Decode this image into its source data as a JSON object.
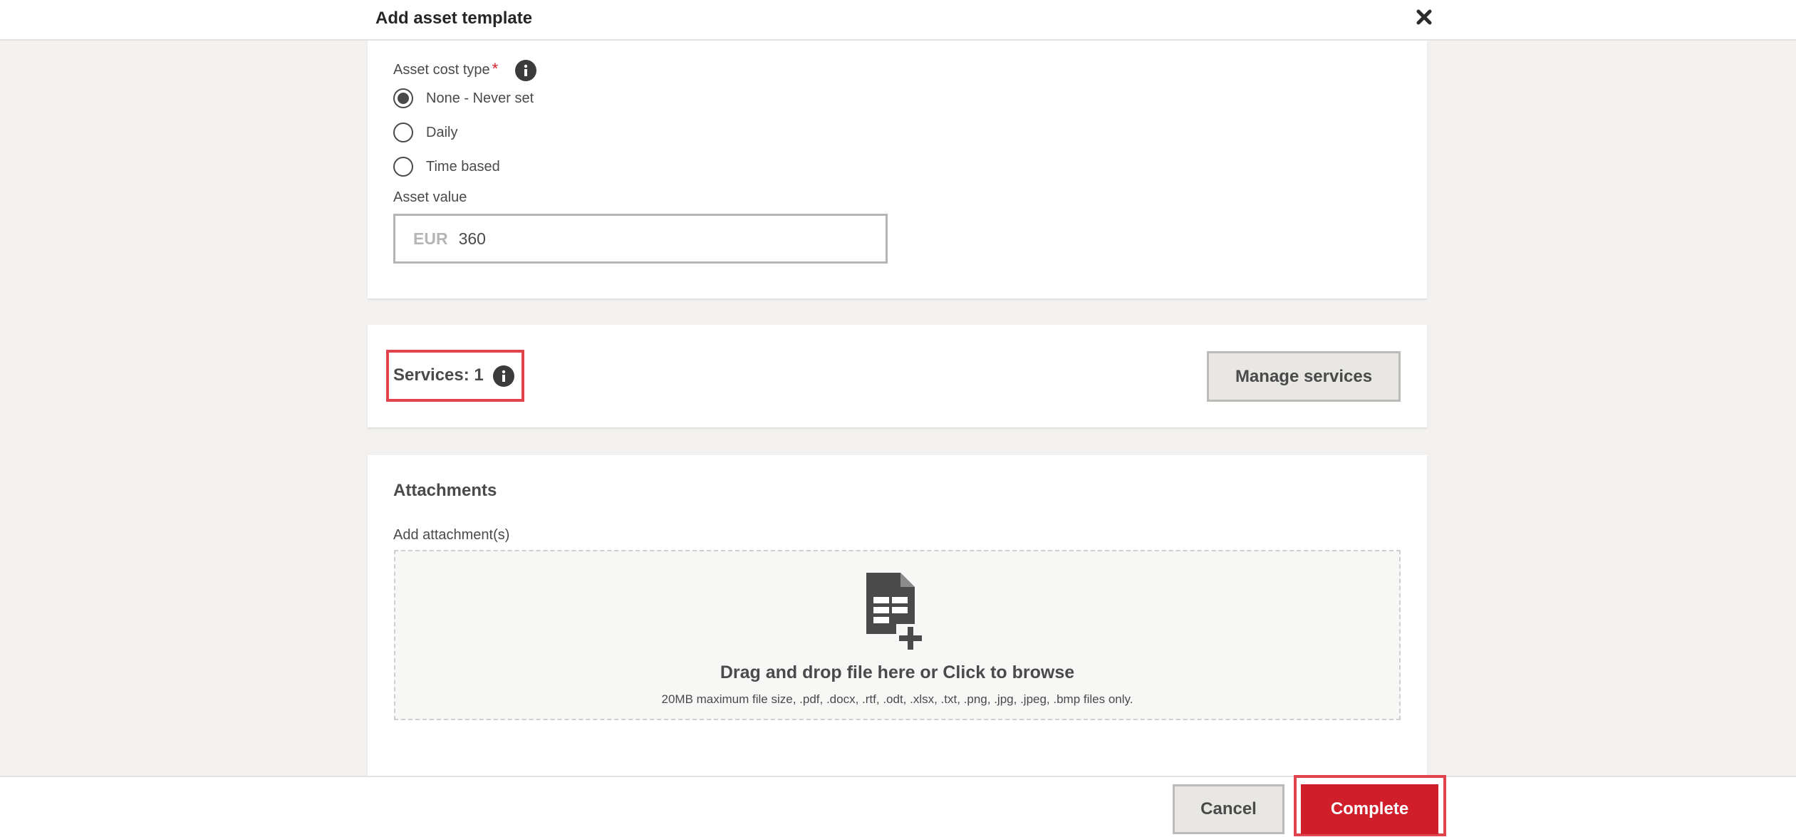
{
  "header": {
    "title": "Add asset template"
  },
  "cost": {
    "label": "Asset cost type",
    "required_mark": "*",
    "options": [
      {
        "label": "None - Never set",
        "selected": true
      },
      {
        "label": "Daily",
        "selected": false
      },
      {
        "label": "Time based",
        "selected": false
      }
    ],
    "asset_value_label": "Asset value",
    "currency": "EUR",
    "asset_value": "360"
  },
  "services": {
    "label": "Services: 1",
    "manage_button": "Manage services"
  },
  "attachments": {
    "title": "Attachments",
    "add_label": "Add attachment(s)",
    "drop_main": "Drag and drop file here or Click to browse",
    "drop_sub": "20MB maximum file size, .pdf, .docx, .rtf, .odt, .xlsx, .txt, .png, .jpg, .jpeg, .bmp files only."
  },
  "footer": {
    "cancel": "Cancel",
    "complete": "Complete"
  },
  "colors": {
    "primary": "#d01f2b",
    "highlight": "#e0434c",
    "background": "#f2f1ef"
  }
}
